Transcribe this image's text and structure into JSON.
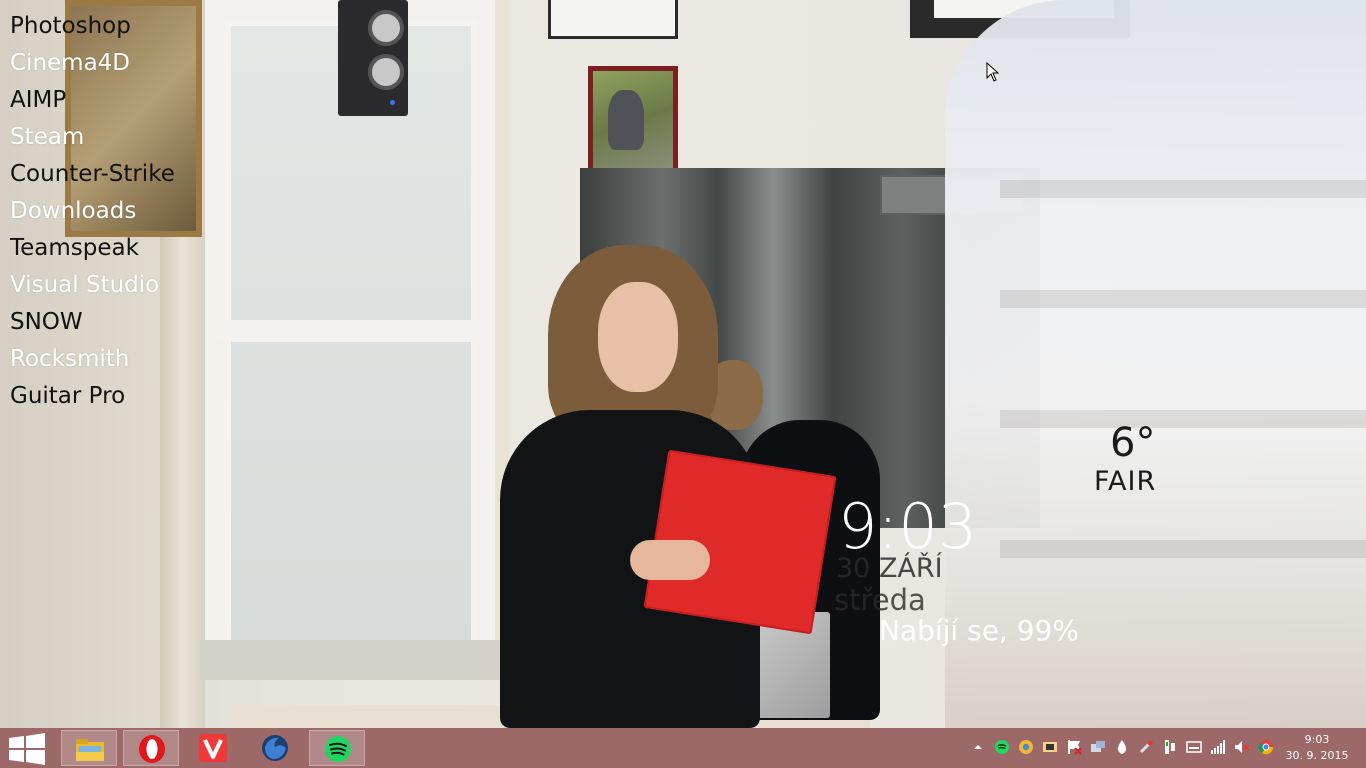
{
  "desktop": {
    "shortcuts": [
      {
        "label": "Photoshop",
        "tone": "dark"
      },
      {
        "label": "Cinema4D",
        "tone": "light"
      },
      {
        "label": "AIMP",
        "tone": "dark"
      },
      {
        "label": "Steam",
        "tone": "light"
      },
      {
        "label": "Counter-Strike",
        "tone": "dark"
      },
      {
        "label": "Downloads",
        "tone": "light"
      },
      {
        "label": "Teamspeak",
        "tone": "dark"
      },
      {
        "label": "Visual Studio",
        "tone": "light"
      },
      {
        "label": "SNOW",
        "tone": "dark"
      },
      {
        "label": "Rocksmith",
        "tone": "light"
      },
      {
        "label": "Guitar Pro",
        "tone": "dark"
      }
    ]
  },
  "weather": {
    "temperature": "6°",
    "condition": "FAIR"
  },
  "clock": {
    "time": "9:03",
    "date": "30 ZÁŘÍ",
    "weekday": "středa"
  },
  "battery": {
    "status": "Nabíjí se, 99%"
  },
  "taskbar": {
    "pinned": [
      {
        "name": "file-explorer",
        "icon": "folder-icon",
        "active": true
      },
      {
        "name": "opera",
        "icon": "opera-icon",
        "active": true
      },
      {
        "name": "vivaldi",
        "icon": "vivaldi-icon",
        "active": false
      },
      {
        "name": "waterfox",
        "icon": "waterfox-icon",
        "active": false
      },
      {
        "name": "spotify",
        "icon": "spotify-icon",
        "active": true
      }
    ],
    "tray_icons": [
      "chevron-up-icon",
      "spotify-icon",
      "chrome-like-icon",
      "flux-icon",
      "flag-icon",
      "network-adapter-icon",
      "drop-icon",
      "usb-icon",
      "power-icon",
      "keyboard-icon",
      "signal-icon",
      "volume-muted-icon",
      "chrome-icon"
    ],
    "clock_time": "9:03",
    "clock_date": "30. 9. 2015"
  },
  "colors": {
    "taskbar": "#965c5c",
    "text_light": "#ffffff",
    "text_dark": "#111111"
  }
}
